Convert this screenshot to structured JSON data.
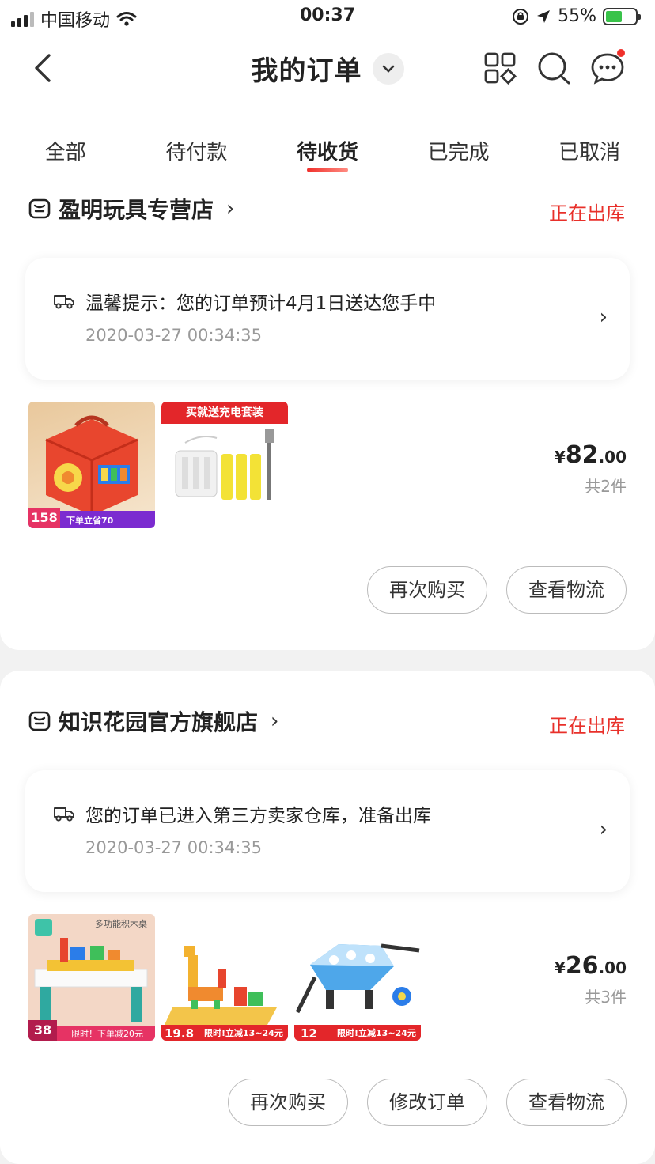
{
  "status_bar": {
    "carrier": "中国移动",
    "time": "00:37",
    "battery": "55%"
  },
  "header": {
    "title": "我的订单"
  },
  "tabs": [
    {
      "label": "全部",
      "active": false
    },
    {
      "label": "待付款",
      "active": false
    },
    {
      "label": "待收货",
      "active": true
    },
    {
      "label": "已完成",
      "active": false
    },
    {
      "label": "已取消",
      "active": false
    }
  ],
  "colors": {
    "accent": "#e8302a",
    "background": "#f2f2f2"
  },
  "orders": [
    {
      "shop_name": "盈明玩具专营店",
      "status": "正在出库",
      "tip": {
        "message": "温馨提示：您的订单预计4月1日送达您手中",
        "time": "2020-03-27 00:34:35"
      },
      "products": [
        {
          "badge": "158",
          "banner": "下单立省70"
        },
        {
          "badge": "",
          "banner": "买就送充电套装"
        }
      ],
      "price": {
        "symbol": "¥",
        "integer": "82",
        "decimal": ".00"
      },
      "count": "共2件",
      "buttons": [
        "再次购买",
        "查看物流"
      ]
    },
    {
      "shop_name": "知识花园官方旗舰店",
      "status": "正在出库",
      "tip": {
        "message": "您的订单已进入第三方卖家仓库，准备出库",
        "time": "2020-03-27 00:34:35"
      },
      "products": [
        {
          "badge": "38",
          "banner": "限时！下单减20元",
          "top": "多功能积木桌"
        },
        {
          "badge": "19.8",
          "banner": "限时!立减13~24元"
        },
        {
          "badge": "12",
          "banner": "限时!立减13~24元"
        }
      ],
      "price": {
        "symbol": "¥",
        "integer": "26",
        "decimal": ".00"
      },
      "count": "共3件",
      "buttons": [
        "再次购买",
        "修改订单",
        "查看物流"
      ]
    }
  ]
}
